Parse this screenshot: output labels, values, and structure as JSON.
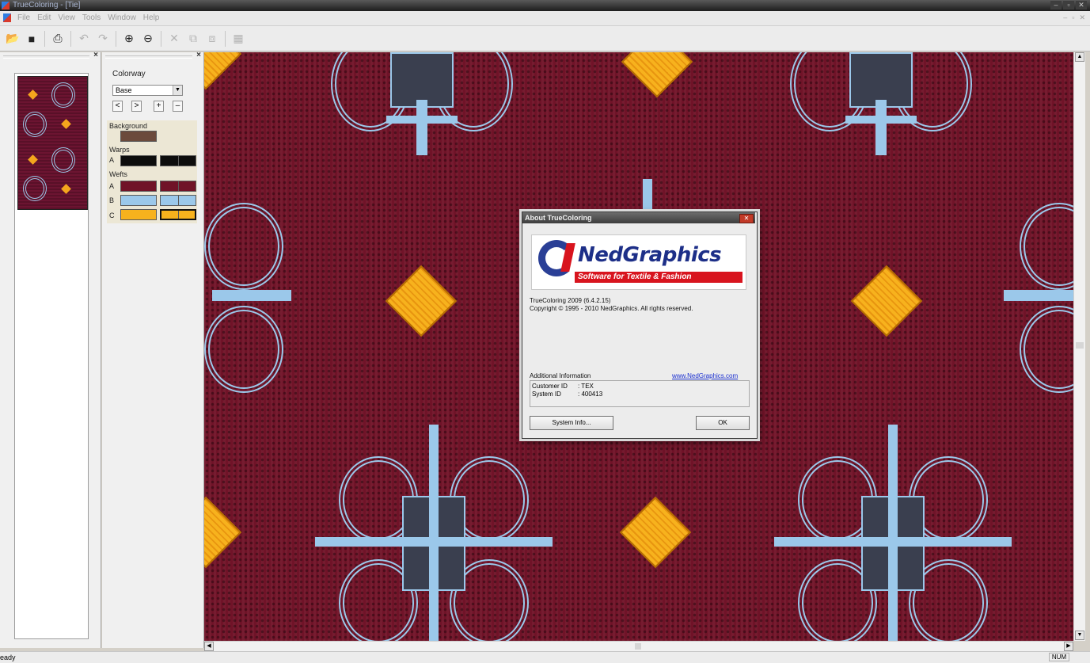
{
  "window": {
    "title": "TrueColoring - [Tie]",
    "min": "–",
    "max": "▫",
    "close": "✕"
  },
  "menu": {
    "items": [
      "File",
      "Edit",
      "View",
      "Tools",
      "Window",
      "Help"
    ],
    "mdi_min": "–",
    "mdi_restore": "▫",
    "mdi_close": "✕"
  },
  "toolbar": {
    "icons": [
      "open-folder-icon",
      "save-icon",
      "print-icon",
      "undo-icon",
      "redo-icon",
      "zoom-in-icon",
      "zoom-out-icon",
      "cut-icon",
      "copy-icon",
      "paste-icon",
      "grid-icon"
    ],
    "glyphs": {
      "open": "📂",
      "save": "■",
      "print": "⎙",
      "undo": "↶",
      "redo": "↷",
      "zoom_in": "⊕",
      "zoom_out": "⊖",
      "cut": "✕",
      "copy": "⧉",
      "paste": "⧈",
      "grid": "▦"
    }
  },
  "thumbnail_panel": {
    "close": "×"
  },
  "colorway_panel": {
    "close": "×",
    "label": "Colorway",
    "selected": "Base",
    "nav": [
      "<",
      ">",
      "+",
      "–"
    ],
    "background_label": "Background",
    "warps_label": "Warps",
    "wefts_label": "Wefts",
    "rows": {
      "warp_a": "A",
      "weft_a": "A",
      "weft_b": "B",
      "weft_c": "C"
    },
    "colors": {
      "background": "#6b4a3c",
      "warp_a": "#0d0d0d",
      "weft_a": "#701328",
      "weft_b": "#9bc8ea",
      "weft_c": "#f7b21d"
    }
  },
  "dialog": {
    "title": "About TrueColoring",
    "close": "✕",
    "logo_word": "NedGraphics",
    "logo_tagline": "Software for Textile & Fashion",
    "version": "TrueColoring 2009 (6.4.2.15)",
    "copyright": "Copyright © 1995 - 2010 NedGraphics. All rights reserved.",
    "additional_info_label": "Additional Information",
    "link": "www.NedGraphics.com",
    "customer_id_label": "Customer ID",
    "customer_id_value": ": TEX",
    "system_id_label": "System ID",
    "system_id_value": ": 400413",
    "system_info_button": "System Info...",
    "ok_button": "OK"
  },
  "scroll": {
    "up": "▲",
    "down": "▼",
    "left": "◀",
    "right": "▶"
  },
  "status": {
    "message": "eady",
    "num": "NUM"
  }
}
